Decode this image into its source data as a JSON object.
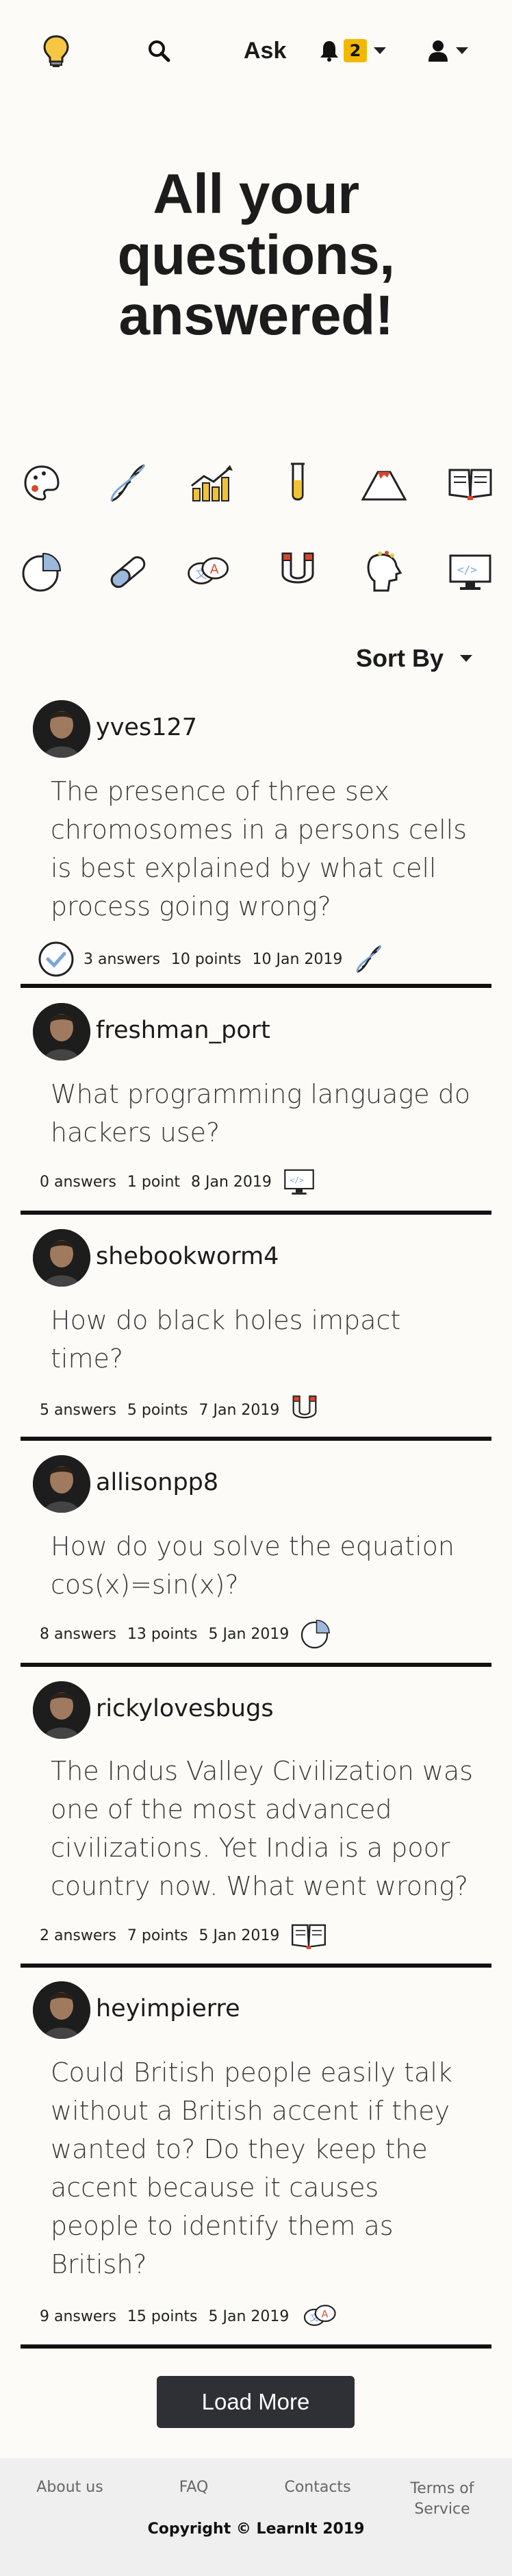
{
  "nav": {
    "ask_label": "Ask",
    "notification_count": "2",
    "icons": [
      "lightbulb-icon",
      "search-icon",
      "bell-icon",
      "user-icon"
    ]
  },
  "hero": {
    "title_line1": "All your",
    "title_line2": "questions,",
    "title_line3": "answered!"
  },
  "categories": [
    "palette-icon",
    "dna-icon",
    "chart-icon",
    "test-tube-icon",
    "volcano-icon",
    "book-icon",
    "pie-chart-icon",
    "pill-icon",
    "language-icon",
    "magnet-icon",
    "head-icon",
    "computer-code-icon"
  ],
  "sort": {
    "label": "Sort By"
  },
  "questions": [
    {
      "username": "yves127",
      "text": "The presence of three sex chromosomes in a persons cells is best explained by what cell process going wrong?",
      "answers": "3 answers",
      "points": "10 points",
      "date": "10 Jan 2019",
      "answered": true,
      "category_icon": "dna-icon"
    },
    {
      "username": "freshman_port",
      "text": "What programming language do hackers use?",
      "answers": "0 answers",
      "points": "1 point",
      "date": "8 Jan 2019",
      "answered": false,
      "category_icon": "computer-code-icon"
    },
    {
      "username": "shebookworm4",
      "text": "How do black holes impact time?",
      "answers": "5 answers",
      "points": "5 points",
      "date": "7 Jan 2019",
      "answered": false,
      "category_icon": "magnet-icon"
    },
    {
      "username": "allisonpp8",
      "text": "How do you solve the equation cos(x)=sin(x)?",
      "answers": "8 answers",
      "points": "13 points",
      "date": "5 Jan 2019",
      "answered": false,
      "category_icon": "pie-chart-icon"
    },
    {
      "username": "rickylovesbugs",
      "text": "The Indus Valley Civilization was one of the most advanced civilizations. Yet India is a poor country now. What went wrong?",
      "answers": "2 answers",
      "points": "7 points",
      "date": "5 Jan 2019",
      "answered": false,
      "category_icon": "book-icon"
    },
    {
      "username": "heyimpierre",
      "text": "Could British people easily talk without a British accent if they wanted to? Do they keep the accent because it causes people to identify them as British?",
      "answers": "9 answers",
      "points": "15 points",
      "date": "5 Jan 2019",
      "answered": false,
      "category_icon": "language-icon"
    }
  ],
  "load_more": "Load More",
  "footer": {
    "about": "About us",
    "faq": "FAQ",
    "contacts": "Contacts",
    "terms_line1": "Terms of",
    "terms_line2": "Service",
    "copyright": "Copyright © LearnIt 2019"
  }
}
